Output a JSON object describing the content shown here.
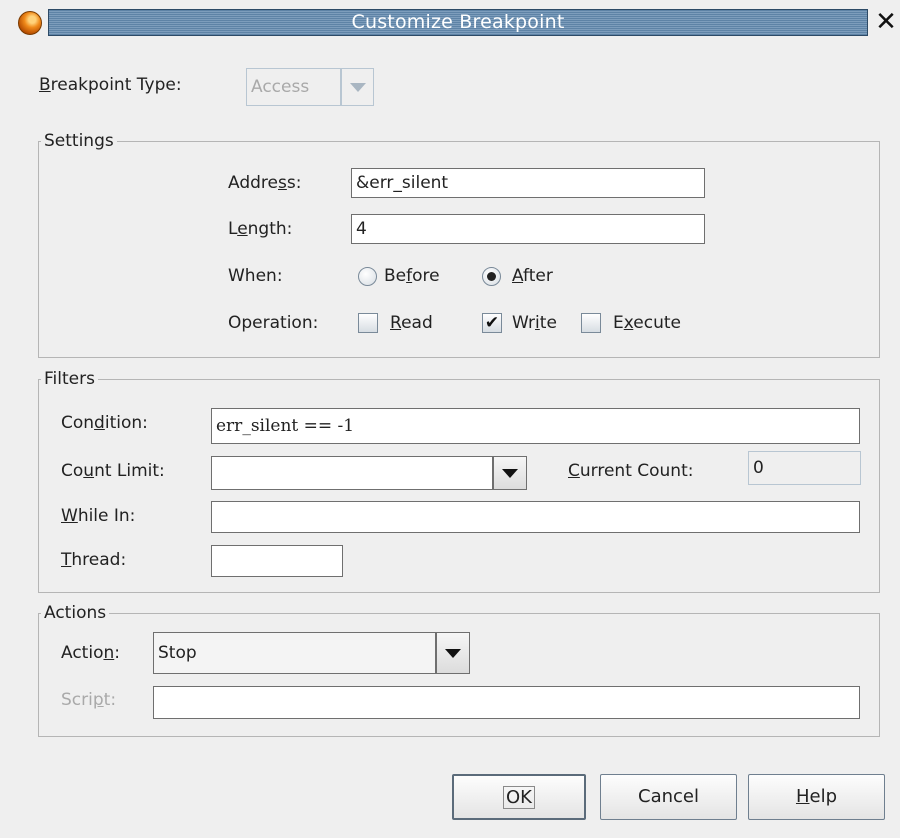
{
  "window": {
    "title": "Customize Breakpoint"
  },
  "breakpoint_type": {
    "label_prefix": "B",
    "label_rest": "reakpoint Type:",
    "value": "Access"
  },
  "settings": {
    "legend": "Settings",
    "address": {
      "label_a": "Addre",
      "label_u": "s",
      "label_b": "s:",
      "value": "&err_silent"
    },
    "length": {
      "label_a": "L",
      "label_u": "e",
      "label_b": "ngth:",
      "value": "4"
    },
    "when": {
      "label": "When:",
      "before": {
        "a": "Be",
        "u": "f",
        "b": "ore",
        "selected": false
      },
      "after": {
        "a": "",
        "u": "A",
        "b": "fter",
        "selected": true
      }
    },
    "operation": {
      "label": "Operation:",
      "read": {
        "a": "",
        "u": "R",
        "b": "ead",
        "checked": false
      },
      "write": {
        "a": "Wr",
        "u": "i",
        "b": "te",
        "checked": true
      },
      "execute": {
        "a": "E",
        "u": "x",
        "b": "ecute",
        "checked": false
      }
    }
  },
  "filters": {
    "legend": "Filters",
    "condition": {
      "label_a": "Con",
      "label_u": "d",
      "label_b": "ition:",
      "value": "err_silent == -1"
    },
    "count_limit": {
      "label_a": "Co",
      "label_u": "u",
      "label_b": "nt Limit:",
      "value": ""
    },
    "current_count": {
      "label_a": "",
      "label_u": "C",
      "label_b": "urrent Count:",
      "value": "0"
    },
    "while_in": {
      "label_a": "",
      "label_u": "W",
      "label_b": "hile In:",
      "value": ""
    },
    "thread": {
      "label_a": "",
      "label_u": "T",
      "label_b": "hread:",
      "value": ""
    }
  },
  "actions": {
    "legend": "Actions",
    "action": {
      "label_a": "Actio",
      "label_u": "n",
      "label_b": ":",
      "value": "Stop"
    },
    "script": {
      "label_a": "Scri",
      "label_u": "p",
      "label_b": "t:",
      "value": ""
    }
  },
  "buttons": {
    "ok": "OK",
    "cancel": "Cancel",
    "help": {
      "a": "",
      "u": "H",
      "b": "elp"
    }
  },
  "icons": {
    "app": "app-icon",
    "close": "close-icon",
    "dropdown": "chevron-down-icon"
  }
}
